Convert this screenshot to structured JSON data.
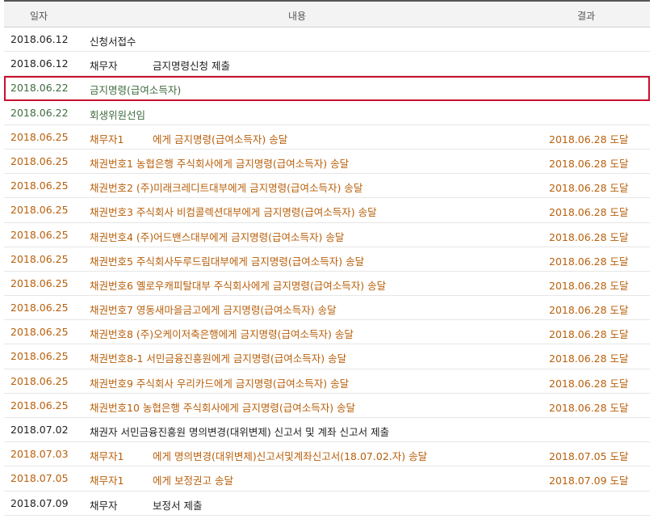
{
  "headers": {
    "date": "일자",
    "content": "내용",
    "result": "결과"
  },
  "colors": {
    "dark": "#222222",
    "green": "#3f6b3f",
    "orange": "#b8600c",
    "highlight_border": "#c8102e"
  },
  "rows": [
    {
      "date": "2018.06.12",
      "prefix": "",
      "content": "신청서접수",
      "result": "",
      "color": "#222222",
      "highlight": false
    },
    {
      "date": "2018.06.12",
      "prefix": "채무자",
      "content": "금지명령신청 제출",
      "result": "",
      "color": "#222222",
      "highlight": false
    },
    {
      "date": "2018.06.22",
      "prefix": "",
      "content": "금지명령(급여소득자)",
      "result": "",
      "color": "#3f6b3f",
      "highlight": true
    },
    {
      "date": "2018.06.22",
      "prefix": "",
      "content": "회생위원선임",
      "result": "",
      "color": "#3f6b3f",
      "highlight": false
    },
    {
      "date": "2018.06.25",
      "prefix": "채무자1",
      "content": "에게 금지명령(급여소득자) 송달",
      "result": "2018.06.28 도달",
      "color": "#b8600c",
      "highlight": false
    },
    {
      "date": "2018.06.25",
      "prefix": "",
      "content": "채권번호1 농협은행 주식회사에게 금지명령(급여소득자) 송달",
      "result": "2018.06.28 도달",
      "color": "#b8600c",
      "highlight": false
    },
    {
      "date": "2018.06.25",
      "prefix": "",
      "content": "채권번호2 (주)미래크레디트대부에게 금지명령(급여소득자) 송달",
      "result": "2018.06.28 도달",
      "color": "#b8600c",
      "highlight": false
    },
    {
      "date": "2018.06.25",
      "prefix": "",
      "content": "채권번호3 주식회사 비컴콜렉션대부에게 금지명령(급여소득자) 송달",
      "result": "2018.06.28 도달",
      "color": "#b8600c",
      "highlight": false
    },
    {
      "date": "2018.06.25",
      "prefix": "",
      "content": "채권번호4 (주)어드밴스대부에게 금지명령(급여소득자) 송달",
      "result": "2018.06.28 도달",
      "color": "#b8600c",
      "highlight": false
    },
    {
      "date": "2018.06.25",
      "prefix": "",
      "content": "채권번호5 주식회사두루드림대부에게 금지명령(급여소득자) 송달",
      "result": "2018.06.28 도달",
      "color": "#b8600c",
      "highlight": false
    },
    {
      "date": "2018.06.25",
      "prefix": "",
      "content": "채권번호6 옐로우캐피탈대부 주식회사에게 금지명령(급여소득자) 송달",
      "result": "2018.06.28 도달",
      "color": "#b8600c",
      "highlight": false
    },
    {
      "date": "2018.06.25",
      "prefix": "",
      "content": "채권번호7 영동새마을금고에게 금지명령(급여소득자) 송달",
      "result": "2018.06.28 도달",
      "color": "#b8600c",
      "highlight": false
    },
    {
      "date": "2018.06.25",
      "prefix": "",
      "content": "채권번호8 (주)오케이저축은행에게 금지명령(급여소득자) 송달",
      "result": "2018.06.28 도달",
      "color": "#b8600c",
      "highlight": false
    },
    {
      "date": "2018.06.25",
      "prefix": "",
      "content": "채권번호8-1 서민금융진흥원에게 금지명령(급여소득자) 송달",
      "result": "2018.06.28 도달",
      "color": "#b8600c",
      "highlight": false
    },
    {
      "date": "2018.06.25",
      "prefix": "",
      "content": "채권번호9 주식회사 우리카드에게 금지명령(급여소득자) 송달",
      "result": "2018.06.28 도달",
      "color": "#b8600c",
      "highlight": false
    },
    {
      "date": "2018.06.25",
      "prefix": "",
      "content": "채권번호10 농협은행 주식회사에게 금지명령(급여소득자) 송달",
      "result": "2018.06.28 도달",
      "color": "#b8600c",
      "highlight": false
    },
    {
      "date": "2018.07.02",
      "prefix": "",
      "content": "채권자 서민금융진흥원 명의변경(대위변제) 신고서 및 계좌 신고서 제출",
      "result": "",
      "color": "#222222",
      "highlight": false
    },
    {
      "date": "2018.07.03",
      "prefix": "채무자1",
      "content": "에게 명의변경(대위변제)신고서및계좌신고서(18.07.02.자) 송달",
      "result": "2018.07.05 도달",
      "color": "#b8600c",
      "highlight": false
    },
    {
      "date": "2018.07.05",
      "prefix": "채무자1",
      "content": "에게 보정권고 송달",
      "result": "2018.07.09 도달",
      "color": "#b8600c",
      "highlight": false
    },
    {
      "date": "2018.07.09",
      "prefix": "채무자",
      "content": "보정서 제출",
      "result": "",
      "color": "#222222",
      "highlight": false
    }
  ]
}
